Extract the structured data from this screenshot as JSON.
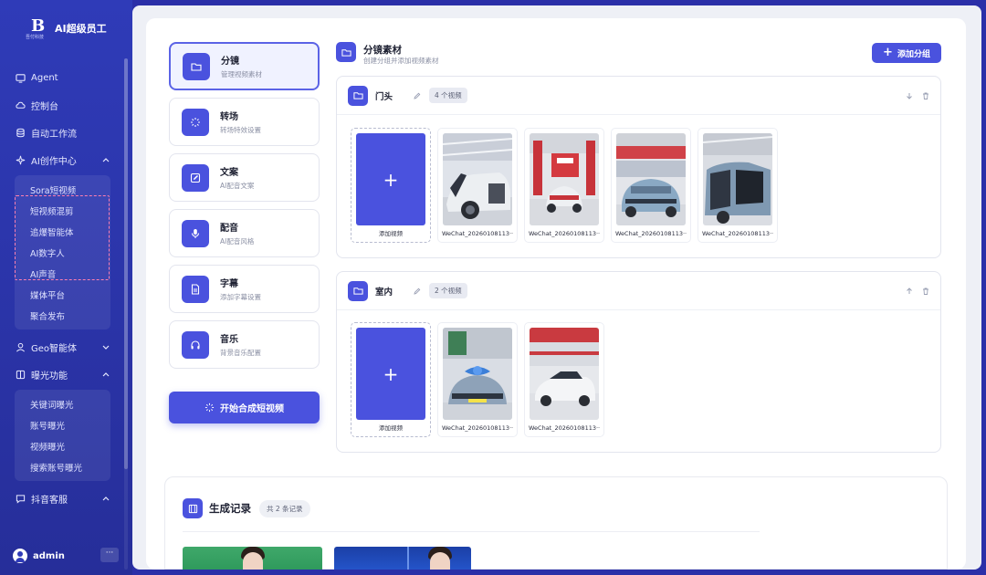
{
  "app": {
    "logo_text": "B",
    "logo_sub": "吾付科技",
    "title": "AI超级员工"
  },
  "sidebar": {
    "items": [
      {
        "label": "Agent",
        "icon": "monitor-icon"
      },
      {
        "label": "控制台",
        "icon": "cloud-icon"
      },
      {
        "label": "自动工作流",
        "icon": "stack-icon"
      },
      {
        "label": "AI创作中心",
        "icon": "sparkle-icon",
        "expanded": true
      }
    ],
    "ai_sub": [
      "Sora短视频",
      "短视频混剪",
      "追爆智能体",
      "AI数字人",
      "AI声音",
      "媒体平台",
      "聚合发布"
    ],
    "items2": [
      {
        "label": "Geo智能体",
        "icon": "geo-icon",
        "expanded": false
      },
      {
        "label": "曝光功能",
        "icon": "megaphone-icon",
        "expanded": true
      }
    ],
    "exposure_sub": [
      "关键词曝光",
      "账号曝光",
      "视频曝光",
      "搜索账号曝光"
    ],
    "items3": [
      {
        "label": "抖音客服",
        "icon": "chat-icon",
        "expanded": true
      }
    ],
    "user": {
      "name": "admin",
      "more": "···"
    }
  },
  "steps": [
    {
      "title": "分镜",
      "sub": "管理视频素材",
      "icon": "folder-icon",
      "active": true
    },
    {
      "title": "转场",
      "sub": "转场特效设置",
      "icon": "sparkle-icon",
      "active": false
    },
    {
      "title": "文案",
      "sub": "AI配音文案",
      "icon": "edit-icon",
      "active": false
    },
    {
      "title": "配音",
      "sub": "AI配音风格",
      "icon": "mic-icon",
      "active": false
    },
    {
      "title": "字幕",
      "sub": "添加字幕设置",
      "icon": "document-icon",
      "active": false
    },
    {
      "title": "音乐",
      "sub": "背景音乐配置",
      "icon": "headphones-icon",
      "active": false
    }
  ],
  "start_button": "开始合成短视频",
  "header": {
    "title": "分镜素材",
    "subtitle": "创建分组并添加视频素材",
    "add_group": "添加分组"
  },
  "groups": [
    {
      "name": "门头",
      "badge": "4 个视频",
      "add_label": "添加视频",
      "videos": [
        {
          "caption": "WeChat_20260108113···",
          "scene": "car-white-open"
        },
        {
          "caption": "WeChat_20260108113···",
          "scene": "showroom-red"
        },
        {
          "caption": "WeChat_20260108113···",
          "scene": "car-blue-front"
        },
        {
          "caption": "WeChat_20260108113···",
          "scene": "car-interior"
        }
      ]
    },
    {
      "name": "室内",
      "badge": "2 个视频",
      "add_label": "添加视频",
      "videos": [
        {
          "caption": "WeChat_20260108113···",
          "scene": "car-ribbon"
        },
        {
          "caption": "WeChat_20260108113···",
          "scene": "car-white-side"
        }
      ]
    }
  ],
  "records": {
    "title": "生成记录",
    "badge": "共 2 条记录"
  },
  "colors": {
    "sidebar": "#2f3bb8",
    "accent": "#4a52de",
    "highlight_dash": "#ff7fb0"
  }
}
